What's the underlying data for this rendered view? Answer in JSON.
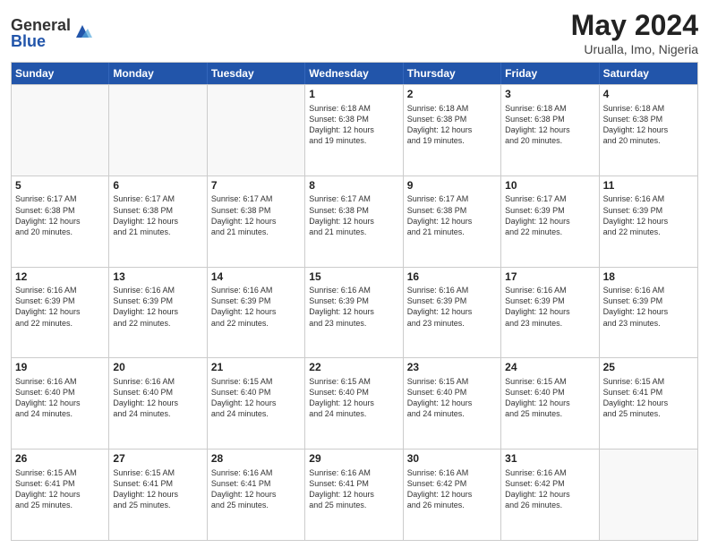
{
  "logo": {
    "general": "General",
    "blue": "Blue"
  },
  "title": {
    "month_year": "May 2024",
    "location": "Urualla, Imo, Nigeria"
  },
  "header": {
    "days": [
      "Sunday",
      "Monday",
      "Tuesday",
      "Wednesday",
      "Thursday",
      "Friday",
      "Saturday"
    ]
  },
  "rows": [
    {
      "cells": [
        {
          "day": "",
          "info": "",
          "empty": true
        },
        {
          "day": "",
          "info": "",
          "empty": true
        },
        {
          "day": "",
          "info": "",
          "empty": true
        },
        {
          "day": "1",
          "info": "Sunrise: 6:18 AM\nSunset: 6:38 PM\nDaylight: 12 hours\nand 19 minutes."
        },
        {
          "day": "2",
          "info": "Sunrise: 6:18 AM\nSunset: 6:38 PM\nDaylight: 12 hours\nand 19 minutes."
        },
        {
          "day": "3",
          "info": "Sunrise: 6:18 AM\nSunset: 6:38 PM\nDaylight: 12 hours\nand 20 minutes."
        },
        {
          "day": "4",
          "info": "Sunrise: 6:18 AM\nSunset: 6:38 PM\nDaylight: 12 hours\nand 20 minutes."
        }
      ]
    },
    {
      "cells": [
        {
          "day": "5",
          "info": "Sunrise: 6:17 AM\nSunset: 6:38 PM\nDaylight: 12 hours\nand 20 minutes."
        },
        {
          "day": "6",
          "info": "Sunrise: 6:17 AM\nSunset: 6:38 PM\nDaylight: 12 hours\nand 21 minutes."
        },
        {
          "day": "7",
          "info": "Sunrise: 6:17 AM\nSunset: 6:38 PM\nDaylight: 12 hours\nand 21 minutes."
        },
        {
          "day": "8",
          "info": "Sunrise: 6:17 AM\nSunset: 6:38 PM\nDaylight: 12 hours\nand 21 minutes."
        },
        {
          "day": "9",
          "info": "Sunrise: 6:17 AM\nSunset: 6:38 PM\nDaylight: 12 hours\nand 21 minutes."
        },
        {
          "day": "10",
          "info": "Sunrise: 6:17 AM\nSunset: 6:39 PM\nDaylight: 12 hours\nand 22 minutes."
        },
        {
          "day": "11",
          "info": "Sunrise: 6:16 AM\nSunset: 6:39 PM\nDaylight: 12 hours\nand 22 minutes."
        }
      ]
    },
    {
      "cells": [
        {
          "day": "12",
          "info": "Sunrise: 6:16 AM\nSunset: 6:39 PM\nDaylight: 12 hours\nand 22 minutes."
        },
        {
          "day": "13",
          "info": "Sunrise: 6:16 AM\nSunset: 6:39 PM\nDaylight: 12 hours\nand 22 minutes."
        },
        {
          "day": "14",
          "info": "Sunrise: 6:16 AM\nSunset: 6:39 PM\nDaylight: 12 hours\nand 22 minutes."
        },
        {
          "day": "15",
          "info": "Sunrise: 6:16 AM\nSunset: 6:39 PM\nDaylight: 12 hours\nand 23 minutes."
        },
        {
          "day": "16",
          "info": "Sunrise: 6:16 AM\nSunset: 6:39 PM\nDaylight: 12 hours\nand 23 minutes."
        },
        {
          "day": "17",
          "info": "Sunrise: 6:16 AM\nSunset: 6:39 PM\nDaylight: 12 hours\nand 23 minutes."
        },
        {
          "day": "18",
          "info": "Sunrise: 6:16 AM\nSunset: 6:39 PM\nDaylight: 12 hours\nand 23 minutes."
        }
      ]
    },
    {
      "cells": [
        {
          "day": "19",
          "info": "Sunrise: 6:16 AM\nSunset: 6:40 PM\nDaylight: 12 hours\nand 24 minutes."
        },
        {
          "day": "20",
          "info": "Sunrise: 6:16 AM\nSunset: 6:40 PM\nDaylight: 12 hours\nand 24 minutes."
        },
        {
          "day": "21",
          "info": "Sunrise: 6:15 AM\nSunset: 6:40 PM\nDaylight: 12 hours\nand 24 minutes."
        },
        {
          "day": "22",
          "info": "Sunrise: 6:15 AM\nSunset: 6:40 PM\nDaylight: 12 hours\nand 24 minutes."
        },
        {
          "day": "23",
          "info": "Sunrise: 6:15 AM\nSunset: 6:40 PM\nDaylight: 12 hours\nand 24 minutes."
        },
        {
          "day": "24",
          "info": "Sunrise: 6:15 AM\nSunset: 6:40 PM\nDaylight: 12 hours\nand 25 minutes."
        },
        {
          "day": "25",
          "info": "Sunrise: 6:15 AM\nSunset: 6:41 PM\nDaylight: 12 hours\nand 25 minutes."
        }
      ]
    },
    {
      "cells": [
        {
          "day": "26",
          "info": "Sunrise: 6:15 AM\nSunset: 6:41 PM\nDaylight: 12 hours\nand 25 minutes."
        },
        {
          "day": "27",
          "info": "Sunrise: 6:15 AM\nSunset: 6:41 PM\nDaylight: 12 hours\nand 25 minutes."
        },
        {
          "day": "28",
          "info": "Sunrise: 6:16 AM\nSunset: 6:41 PM\nDaylight: 12 hours\nand 25 minutes."
        },
        {
          "day": "29",
          "info": "Sunrise: 6:16 AM\nSunset: 6:41 PM\nDaylight: 12 hours\nand 25 minutes."
        },
        {
          "day": "30",
          "info": "Sunrise: 6:16 AM\nSunset: 6:42 PM\nDaylight: 12 hours\nand 26 minutes."
        },
        {
          "day": "31",
          "info": "Sunrise: 6:16 AM\nSunset: 6:42 PM\nDaylight: 12 hours\nand 26 minutes."
        },
        {
          "day": "",
          "info": "",
          "empty": true
        }
      ]
    }
  ]
}
